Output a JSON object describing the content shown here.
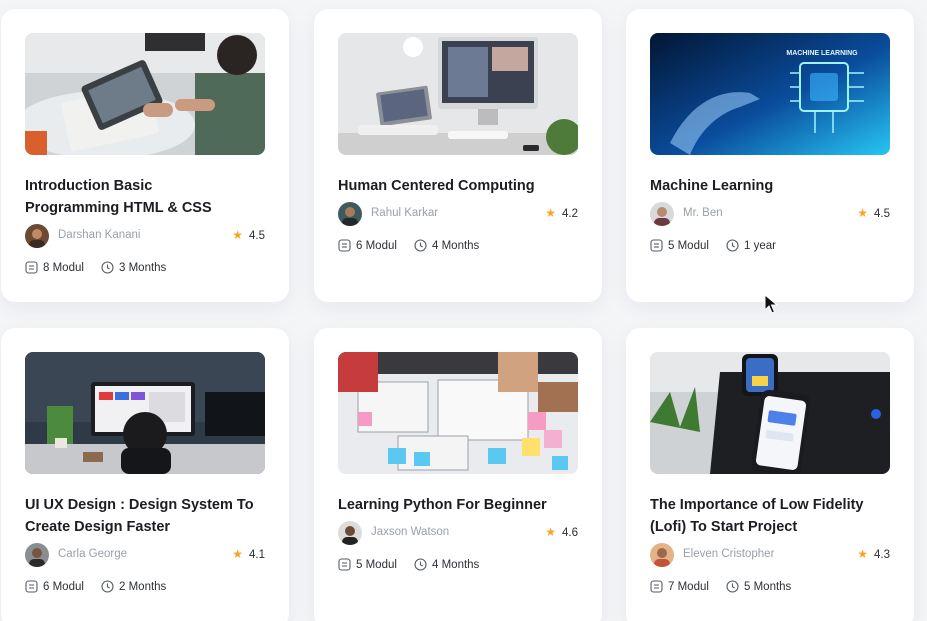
{
  "courses": [
    {
      "title_line1": "Introduction Basic",
      "title_line2": "Programming HTML & CSS",
      "author": "Darshan Kanani",
      "rating": "4.5",
      "modules": "8 Modul",
      "duration": "3 Months"
    },
    {
      "title_line1": "Human Centered Computing",
      "title_line2": "",
      "author": "Rahul Karkar",
      "rating": "4.2",
      "modules": "6 Modul",
      "duration": "4 Months"
    },
    {
      "title_line1": "Machine Learning",
      "title_line2": "",
      "author": "Mr. Ben",
      "rating": "4.5",
      "modules": "5 Modul",
      "duration": "1 year",
      "image_text": "MACHINE LEARNING"
    },
    {
      "title_line1": "UI UX Design : Design System To",
      "title_line2": "Create Design Faster",
      "author": "Carla George",
      "rating": "4.1",
      "modules": "6 Modul",
      "duration": "2 Months"
    },
    {
      "title_line1": "Learning Python For Beginner",
      "title_line2": "",
      "author": "Jaxson Watson",
      "rating": "4.6",
      "modules": "5 Modul",
      "duration": "4 Months"
    },
    {
      "title_line1": "The Importance of Low Fidelity",
      "title_line2": "(Lofi) To Start Project",
      "author": "Eleven Cristopher",
      "rating": "4.3",
      "modules": "7 Modul",
      "duration": "5 Months"
    }
  ],
  "icons": {
    "star": "star-icon",
    "modules": "list-document-icon",
    "duration": "clock-icon",
    "pointer": "mouse-cursor-icon"
  },
  "colors": {
    "star": "#f5a623",
    "author_text": "#9aa0a8",
    "card_bg": "#ffffff",
    "page_bg": "#f4f5f7"
  }
}
